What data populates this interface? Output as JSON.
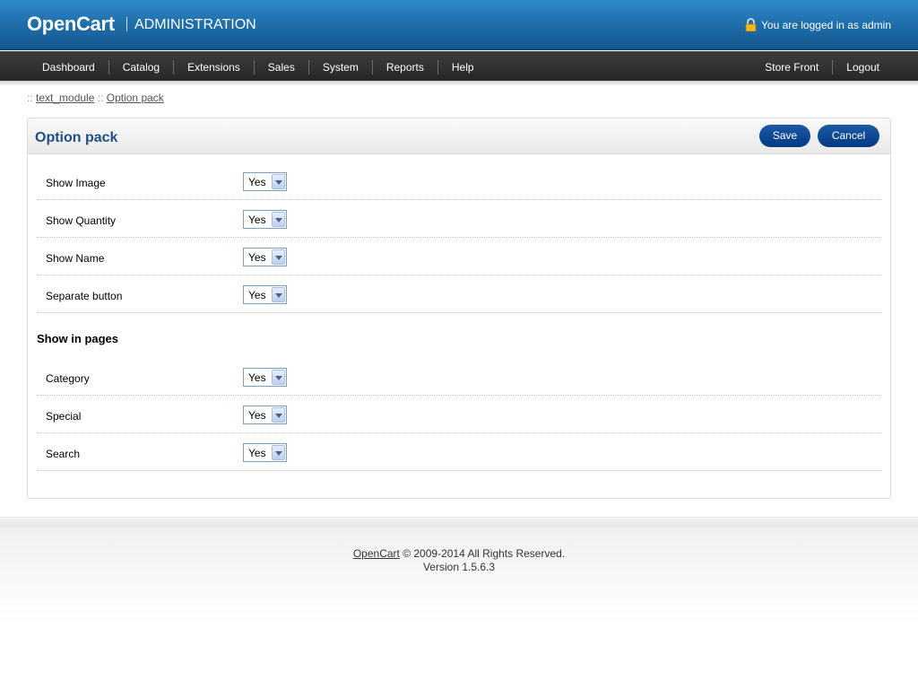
{
  "header": {
    "logo": "OpenCart",
    "subtitle": "ADMINISTRATION",
    "logged_in_text": "You are logged in as admin"
  },
  "menu": {
    "left": [
      "Dashboard",
      "Catalog",
      "Extensions",
      "Sales",
      "System",
      "Reports",
      "Help"
    ],
    "right": [
      "Store Front",
      "Logout"
    ]
  },
  "breadcrumb": {
    "separator": "::",
    "items": [
      "text_module",
      "Option pack"
    ]
  },
  "box": {
    "title": "Option pack",
    "save_label": "Save",
    "cancel_label": "Cancel"
  },
  "settings": [
    {
      "label": "Show Image",
      "value": "Yes"
    },
    {
      "label": "Show Quantity",
      "value": "Yes"
    },
    {
      "label": "Show Name",
      "value": "Yes"
    },
    {
      "label": "Separate button",
      "value": "Yes"
    }
  ],
  "pages_section": {
    "title": "Show in pages",
    "items": [
      {
        "label": "Category",
        "value": "Yes"
      },
      {
        "label": "Special",
        "value": "Yes"
      },
      {
        "label": "Search",
        "value": "Yes"
      }
    ]
  },
  "footer": {
    "link": "OpenCart",
    "copyright": " © 2009-2014 All Rights Reserved.",
    "version": "Version 1.5.6.3"
  },
  "icons": {
    "lock": "lock-icon",
    "dropdown": "chevron-down-icon"
  }
}
